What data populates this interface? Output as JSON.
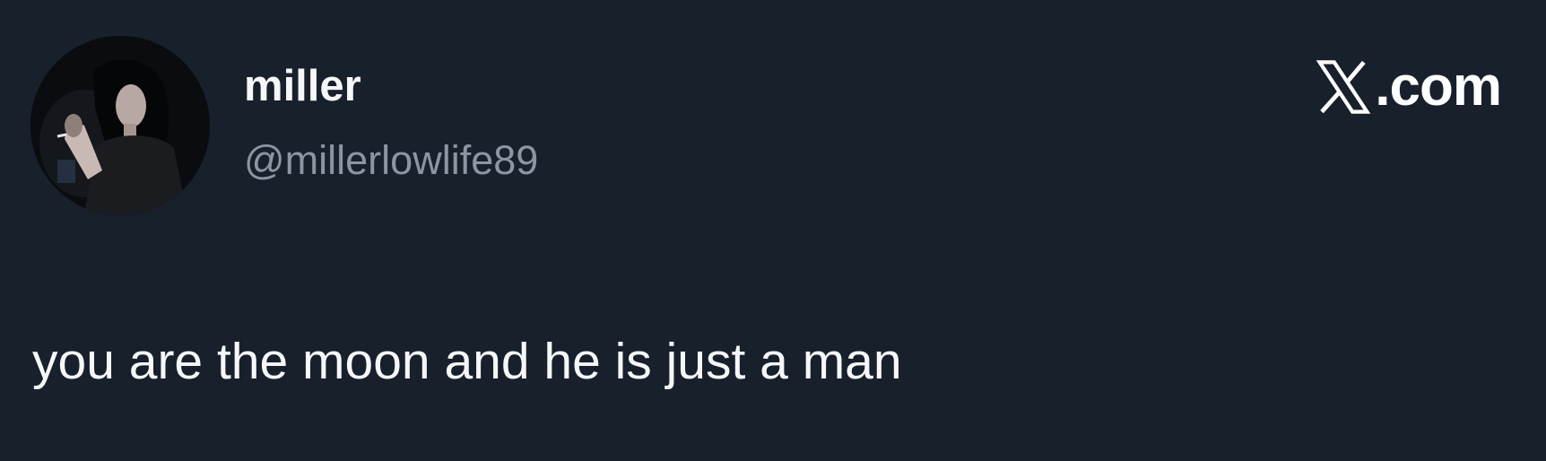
{
  "author": {
    "display_name": "miller",
    "handle": "@millerlowlife89",
    "avatar_icon": "profile-photo"
  },
  "brand": {
    "logo_icon": "x-logo-icon",
    "domain": ".com"
  },
  "tweet": {
    "text": "you are the moon and he is just a man"
  },
  "colors": {
    "background": "#18202c",
    "primary_text": "#f5f7f9",
    "secondary_text": "#8a96a3"
  }
}
